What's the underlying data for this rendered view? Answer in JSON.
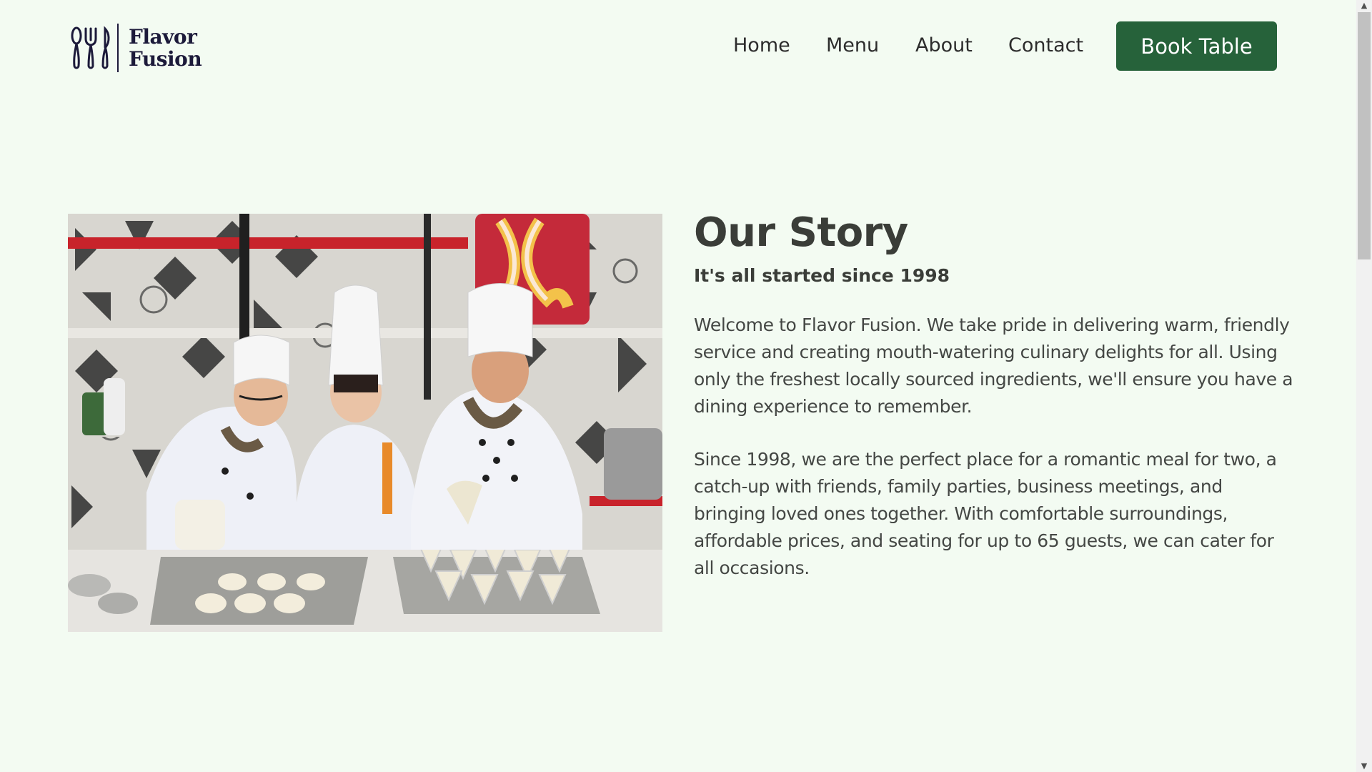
{
  "header": {
    "logo": {
      "line1": "Flavor",
      "line2": "Fusion",
      "icon": "cutlery-icon"
    },
    "nav": [
      {
        "label": "Home"
      },
      {
        "label": "Menu"
      },
      {
        "label": "About"
      },
      {
        "label": "Contact"
      }
    ],
    "cta_label": "Book Table"
  },
  "story": {
    "title": "Our Story",
    "subtitle": "It's all started since 1998",
    "paragraphs": [
      "Welcome to Flavor Fusion. We take pride in delivering warm, friendly service and creating mouth-watering culinary delights for all. Using only the freshest locally sourced ingredients, we'll ensure you have a dining experience to remember.",
      "Since 1998, we are the perfect place for a romantic meal for two, a catch-up with friends, family parties, business meetings, and bringing loved ones together. With comfortable surroundings, affordable prices, and seating for up to 65 guests, we can cater for all occasions."
    ]
  },
  "image": {
    "subject": "chefs-pouring-desserts-photo"
  },
  "colors": {
    "background": "#f3fbf2",
    "brand_dark": "#1c1a3a",
    "cta": "#26623a",
    "text": "#3a3d38"
  }
}
